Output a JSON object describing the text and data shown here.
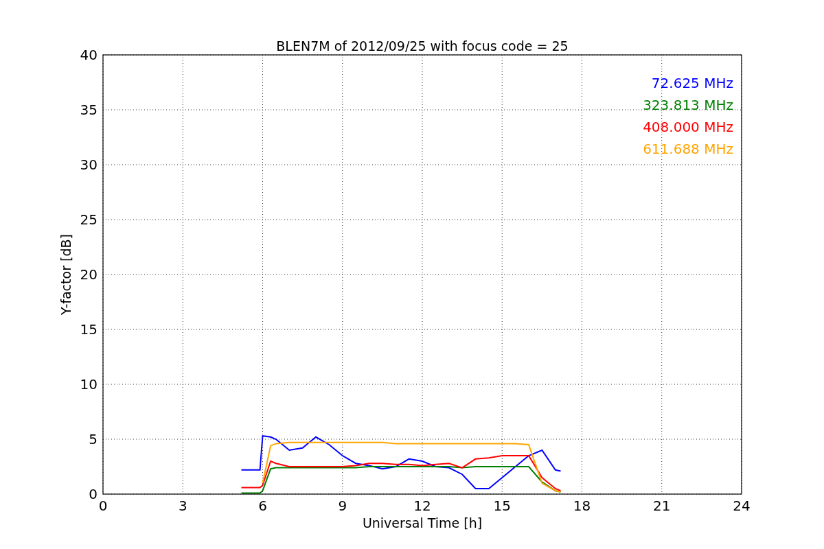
{
  "chart_data": {
    "type": "line",
    "title": "BLEN7M of 2012/09/25 with focus code = 25",
    "xlabel": "Universal Time [h]",
    "ylabel": "Y-factor [dB]",
    "x": [
      5.2,
      5.5,
      5.9,
      6,
      6.3,
      6.5,
      7,
      7.5,
      8,
      8.5,
      9,
      9.5,
      10,
      10.5,
      11,
      11.5,
      12,
      12.5,
      13,
      13.5,
      14,
      14.5,
      15,
      15.5,
      16,
      16.5,
      17,
      17.2
    ],
    "series": [
      {
        "name": "72.625 MHz",
        "color": "#0000ff",
        "values": [
          2.2,
          2.2,
          2.2,
          5.3,
          5.2,
          5.0,
          4.0,
          4.2,
          5.2,
          4.5,
          3.5,
          2.8,
          2.6,
          2.3,
          2.5,
          3.2,
          3.0,
          2.5,
          2.4,
          1.8,
          0.5,
          0.5,
          1.5,
          2.5,
          3.5,
          4.0,
          2.2,
          2.1
        ]
      },
      {
        "name": "323.813 MHz",
        "color": "#008000",
        "values": [
          0.1,
          0.1,
          0.1,
          0.3,
          2.3,
          2.4,
          2.4,
          2.4,
          2.4,
          2.4,
          2.4,
          2.4,
          2.5,
          2.5,
          2.5,
          2.5,
          2.5,
          2.5,
          2.5,
          2.4,
          2.5,
          2.5,
          2.5,
          2.5,
          2.5,
          1.1,
          0.3,
          0.2
        ]
      },
      {
        "name": "408.000 MHz",
        "color": "#ff0000",
        "values": [
          0.6,
          0.6,
          0.6,
          0.8,
          3.0,
          2.8,
          2.5,
          2.5,
          2.5,
          2.5,
          2.5,
          2.6,
          2.8,
          2.8,
          2.7,
          2.7,
          2.6,
          2.7,
          2.8,
          2.4,
          3.2,
          3.3,
          3.5,
          3.5,
          3.5,
          1.5,
          0.5,
          0.3
        ]
      },
      {
        "name": "611.688 MHz",
        "color": "#ffa500",
        "values": [
          null,
          null,
          null,
          1.0,
          4.4,
          4.6,
          4.7,
          4.7,
          4.7,
          4.7,
          4.7,
          4.7,
          4.7,
          4.7,
          4.6,
          4.6,
          4.6,
          4.6,
          4.6,
          4.6,
          4.6,
          4.6,
          4.6,
          4.6,
          4.5,
          1.0,
          0.3,
          0.2
        ]
      }
    ],
    "grid": true,
    "xlim": [
      0,
      24
    ],
    "ylim": [
      0,
      40
    ],
    "xticks": [
      0,
      3,
      6,
      9,
      12,
      15,
      18,
      21,
      24
    ],
    "yticks": [
      0,
      5,
      10,
      15,
      20,
      25,
      30,
      35,
      40
    ]
  }
}
